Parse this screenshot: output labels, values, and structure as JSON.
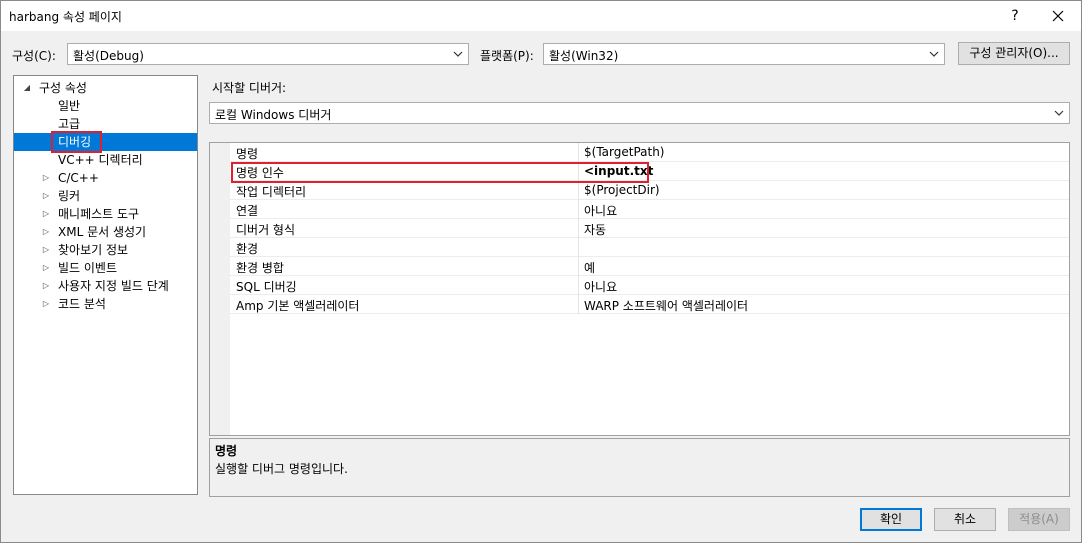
{
  "window": {
    "title": "harbang 속성 페이지",
    "help": "?"
  },
  "config": {
    "label": "구성(C):",
    "value": "활성(Debug)",
    "platform_label": "플랫폼(P):",
    "platform_value": "활성(Win32)",
    "manager_button": "구성 관리자(O)..."
  },
  "tree": {
    "items": [
      {
        "label": "구성 속성",
        "expander": "◢"
      },
      {
        "label": "일반"
      },
      {
        "label": "고급"
      },
      {
        "label": "디버깅"
      },
      {
        "label": "VC++ 디렉터리"
      },
      {
        "label": "C/C++",
        "expander": "▷"
      },
      {
        "label": "링커",
        "expander": "▷"
      },
      {
        "label": "매니페스트 도구",
        "expander": "▷"
      },
      {
        "label": "XML 문서 생성기",
        "expander": "▷"
      },
      {
        "label": "찾아보기 정보",
        "expander": "▷"
      },
      {
        "label": "빌드 이벤트",
        "expander": "▷"
      },
      {
        "label": "사용자 지정 빌드 단계",
        "expander": "▷"
      },
      {
        "label": "코드 분석",
        "expander": "▷"
      }
    ]
  },
  "debugger": {
    "label": "시작할 디버거:",
    "value": "로컬 Windows 디버거"
  },
  "properties": {
    "rows": [
      {
        "name": "명령",
        "value": "$(TargetPath)"
      },
      {
        "name": "명령 인수",
        "value": "<input.txt"
      },
      {
        "name": "작업 디렉터리",
        "value": "$(ProjectDir)"
      },
      {
        "name": "연결",
        "value": "아니요"
      },
      {
        "name": "디버거 형식",
        "value": "자동"
      },
      {
        "name": "환경",
        "value": ""
      },
      {
        "name": "환경 병합",
        "value": "예"
      },
      {
        "name": "SQL 디버깅",
        "value": "아니요"
      },
      {
        "name": "Amp 기본 액셀러레이터",
        "value": "WARP 소프트웨어 액셀러레이터"
      }
    ]
  },
  "description": {
    "title": "명령",
    "text": "실행할 디버그 명령입니다."
  },
  "buttons": {
    "ok": "확인",
    "cancel": "취소",
    "apply": "적용(A)"
  }
}
